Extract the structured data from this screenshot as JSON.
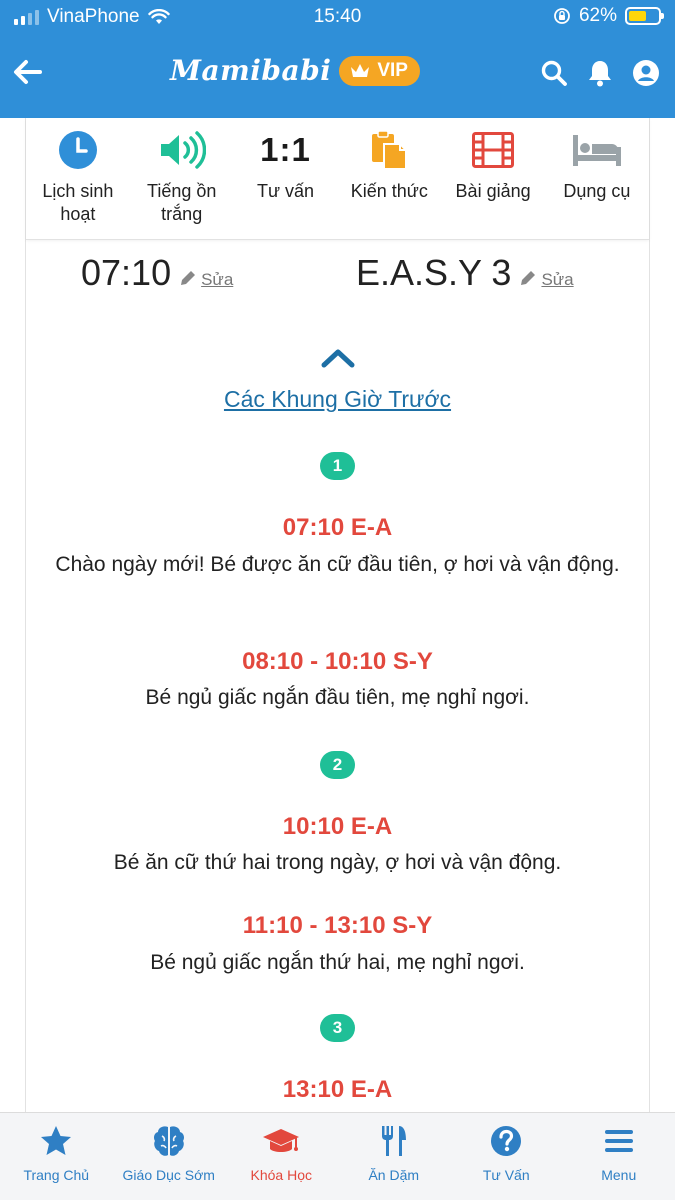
{
  "status_bar": {
    "carrier": "VinaPhone",
    "time": "15:40",
    "battery": "62%",
    "battery_level": 0.62
  },
  "header": {
    "logo": "Mamibabi",
    "vip_label": "VIP",
    "icons": [
      "back-arrow-icon",
      "search-icon",
      "bell-icon",
      "account-icon"
    ]
  },
  "quick_menu": [
    {
      "label": "Lịch sinh hoạt",
      "icon": "clock-icon",
      "color": "#2f8fd8"
    },
    {
      "label": "Tiếng ồn trắng",
      "icon": "speaker-icon",
      "color": "#1fbf97"
    },
    {
      "label": "Tư vấn",
      "icon_text": "1:1"
    },
    {
      "label": "Kiến thức",
      "icon": "clipboard-icon",
      "color": "#f5a623"
    },
    {
      "label": "Bài giảng",
      "icon": "film-icon",
      "color": "#e2483d"
    },
    {
      "label": "Dụng cụ",
      "icon": "bed-icon",
      "color": "#9aa3a8"
    }
  ],
  "schedule": {
    "start_time": "07:10",
    "easy_type": "E.A.S.Y 3",
    "edit_label": "Sửa",
    "prev_link": "Các Khung Giờ Trước",
    "slots": [
      {
        "number": "1",
        "entries": [
          {
            "time": "07:10 E-A",
            "desc": "Chào ngày mới! Bé được ăn cữ đầu tiên, ợ hơi và vận động."
          },
          {
            "time": "08:10 - 10:10 S-Y",
            "desc": "Bé ngủ giấc ngắn đầu tiên, mẹ nghỉ ngơi."
          }
        ]
      },
      {
        "number": "2",
        "entries": [
          {
            "time": "10:10 E-A",
            "desc": "Bé ăn cữ thứ hai trong ngày, ợ hơi và vận động."
          },
          {
            "time": "11:10 - 13:10 S-Y",
            "desc": "Bé ngủ giấc ngắn thứ hai, mẹ nghỉ ngơi."
          }
        ]
      },
      {
        "number": "3",
        "entries": [
          {
            "time": "13:10 E-A",
            "desc": ""
          }
        ]
      }
    ]
  },
  "tabbar": {
    "active": "Khóa Học",
    "items": [
      {
        "label": "Trang Chủ",
        "icon": "star-icon"
      },
      {
        "label": "Giáo Dục Sớm",
        "icon": "brain-icon"
      },
      {
        "label": "Khóa Học",
        "icon": "graduation-cap-icon"
      },
      {
        "label": "Ăn Dặm",
        "icon": "utensils-icon"
      },
      {
        "label": "Tư Vấn",
        "icon": "question-icon"
      },
      {
        "label": "Menu",
        "icon": "hamburger-icon"
      }
    ]
  }
}
